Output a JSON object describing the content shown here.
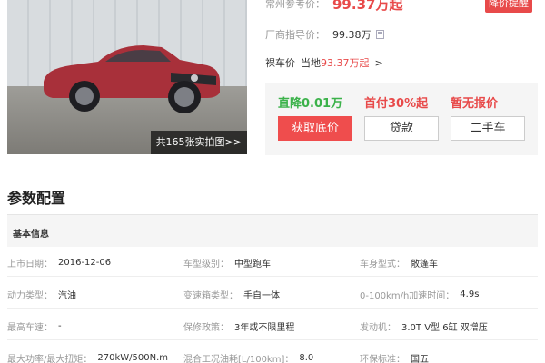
{
  "photo": {
    "count_label": "共165张实拍图>>"
  },
  "price": {
    "label": "常州参考价：",
    "value": "99.37万起",
    "alert_button": "降价提醒"
  },
  "guide": {
    "label": "厂商指导价：",
    "value": "99.38万"
  },
  "bare": {
    "prefix": "裸车价",
    "local": "当地",
    "price": "93.37万起",
    "arrow": ">"
  },
  "offers": {
    "titles": [
      "直降0.01万",
      "首付30%起",
      "暂无报价"
    ],
    "buttons": [
      "获取底价",
      "贷款",
      "二手车"
    ]
  },
  "params": {
    "section_title": "参数配置",
    "group_title": "基本信息",
    "rows": [
      [
        {
          "label": "上市日期：",
          "value": "2016-12-06"
        },
        {
          "label": "车型级别：",
          "value": "中型跑车"
        },
        {
          "label": "车身型式：",
          "value": "敞篷车"
        }
      ],
      [
        {
          "label": "动力类型：",
          "value": "汽油"
        },
        {
          "label": "变速箱类型：",
          "value": "手自一体"
        },
        {
          "label": "0-100km/h加速时间：",
          "value": "4.9s"
        }
      ],
      [
        {
          "label": "最高车速：",
          "value": "-"
        },
        {
          "label": "保修政策：",
          "value": "3年或不限里程"
        },
        {
          "label": "发动机：",
          "value": "3.0T V型 6缸 双增压"
        }
      ],
      [
        {
          "label": "最大功率/最大扭矩：",
          "value": "270kW/500N.m"
        },
        {
          "label": "混合工况油耗[L/100km]：",
          "value": "8.0"
        },
        {
          "label": "环保标准：",
          "value": "国五"
        }
      ]
    ]
  },
  "colors": {
    "accent_red": "#e84a4a",
    "accent_green": "#3bb24a"
  }
}
